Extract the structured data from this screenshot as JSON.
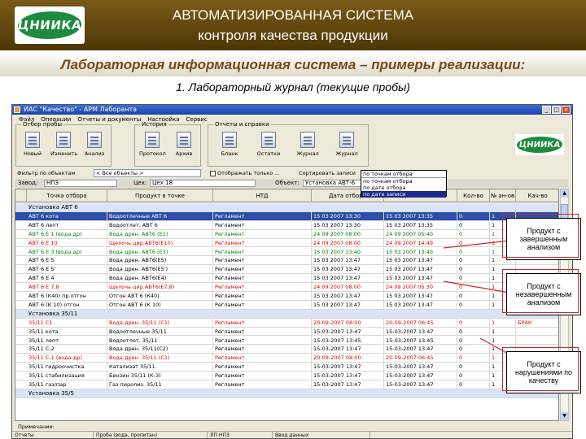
{
  "banner": {
    "logo_text": "ЦНИИКА",
    "title_line1": "АВТОМАТИЗИРОВАННАЯ СИСТЕМА",
    "title_line2": "контроля качества продукции"
  },
  "subtitle": "Лабораторная информационная система – примеры реализации:",
  "caption": "1. Лабораторный журнал (текущие пробы)",
  "window": {
    "title": "ИАС \"Качество\" - АРМ Лаборанта",
    "menu": [
      "Файл",
      "Операции",
      "Отчеты и документы",
      "Настройка",
      "Сервис"
    ],
    "toolbar_groups": [
      {
        "title": "Отбор пробы",
        "buttons": [
          "Новый",
          "Изменить",
          "Анализ"
        ]
      },
      {
        "title": "История",
        "buttons": [
          "Протокол",
          "Архив"
        ]
      },
      {
        "title": "Отчеты и справки",
        "buttons": [
          "Бланк",
          "Остатки",
          "Журнал",
          "Журнал"
        ]
      }
    ],
    "logo_text": "ЦНИИКА",
    "filter": {
      "label": "Фильтр по объектам",
      "value": "< Все объекты >",
      "checkbox_label": "Отображать только ..."
    },
    "sort": {
      "label": "Сортировать записи",
      "value": "по точкам отбора",
      "options": [
        "по точкам отбора",
        "по дате отбора",
        "по дате записи"
      ],
      "selected": "по дате записи"
    },
    "info": {
      "plant_label": "Завод:",
      "plant_value": "НПЗ",
      "shop_label": "Цех:",
      "shop_value": "Цех 18",
      "object_label": "Объект:",
      "object_value": "Установка АВТ-6"
    },
    "columns": [
      "Точка отбора",
      "Продукт в точке",
      "НТД",
      "Дата отбора",
      "Дата записи",
      "Кол-во",
      "№ ан-ов",
      "Кач-во"
    ],
    "rows": [
      {
        "kind": "group",
        "text": "Установка АВТ 6"
      },
      {
        "kind": "selrow",
        "cells": [
          "АВТ 6 кота",
          "Водоотлечные АВТ 6",
          "Регламент",
          "15 03 2007 13:30",
          "15 03 2007 13:35",
          "0",
          "1",
          ""
        ]
      },
      {
        "kind": "normal",
        "cells": [
          "АВТ 6 лепт",
          "Водоотлет. АВТ 6",
          "Регламент",
          "15 03 2007 13:30",
          "15 03 2007 13:35",
          "0",
          "1",
          ""
        ]
      },
      {
        "kind": "green",
        "cells": [
          "АВТ 6 Е 1 (вода др)",
          "Вода дрен. АВТ6 (Е1)",
          "Регламент",
          "24 09 2007 08:00",
          "24 09 2007 05:40",
          "0",
          "1",
          "БРАК"
        ]
      },
      {
        "kind": "red",
        "cells": [
          "АВТ 6 Е 10",
          "Щелочь цир.АВТ6(Е10)",
          "Регламент",
          "24 09 2007 08:00",
          "24 09 2007 14:49",
          "0",
          "1",
          "БРАК"
        ]
      },
      {
        "kind": "green",
        "cells": [
          "АВТ 6 Е 3 (вода др)",
          "Вода дрен. АВТ6 (Е3)",
          "Регламент",
          "15 03 2007 13:40",
          "15 03 2007 13:40",
          "0",
          "1",
          ""
        ]
      },
      {
        "kind": "normal",
        "cells": [
          "АВТ 6 Е 5",
          "Вода дрен. АВТ6(Е5)",
          "Регламент",
          "15 03 2007 13:47",
          "15 03 2007 13:47",
          "0",
          "1",
          ""
        ]
      },
      {
        "kind": "normal",
        "cells": [
          "АВТ 6 Е 5'",
          "Вода дрен. АВТ6(Е5')",
          "Регламент",
          "15 03 2007 13:47",
          "15 03 2007 13:47",
          "0",
          "1",
          ""
        ]
      },
      {
        "kind": "normal",
        "cells": [
          "АВТ 6 Е 4",
          "Вода дрен. АВТ6(Е4)",
          "Регламент",
          "15 03 2007 13:47",
          "15 03 2007 13:47",
          "0",
          "1",
          ""
        ]
      },
      {
        "kind": "red",
        "cells": [
          "АВТ 6 Е 7,8",
          "Щелочь цир.АВТ6(Е7,8)",
          "Регламент",
          "24 09 2007 08:00",
          "24 09 2007 05:30",
          "0",
          "1",
          "БРАК"
        ]
      },
      {
        "kind": "normal",
        "cells": [
          "АВТ 6 (К40) пр.отгон",
          "Отгон АВТ 6 (К40)",
          "Регламент",
          "15 03 2007 13:47",
          "15 03 2007 13:47",
          "0",
          "1",
          ""
        ]
      },
      {
        "kind": "normal",
        "cells": [
          "АВТ 6 (К 10) отгон",
          "Отгон АВТ 6 (К 10)",
          "Регламент",
          "15 03 2007 13:47",
          "15 03 2007 13:47",
          "0",
          "1",
          ""
        ]
      },
      {
        "kind": "group",
        "text": "Установка 35/11"
      },
      {
        "kind": "red",
        "cells": [
          "35/11 С1",
          "Вода дрен. 35/11 (С1)",
          "Регламент",
          "20-09-2007 08:00",
          "20-09-2007 06:45",
          "0",
          "1",
          "БРАК"
        ]
      },
      {
        "kind": "normal",
        "cells": [
          "35/11 кота",
          "Водоотлечные 35/11",
          "Регламент",
          "15-03-2007 13:47",
          "15-03-2007 13:47",
          "0",
          "1",
          ""
        ]
      },
      {
        "kind": "normal",
        "cells": [
          "35/11 лепт",
          "Водоотлет. 35/11",
          "Регламент",
          "15-03-2007 13:45",
          "15-03-2007 13:45",
          "0",
          "1",
          ""
        ]
      },
      {
        "kind": "normal",
        "cells": [
          "35/11 С-2",
          "Вода дрен. 35/11(С2)",
          "Регламент",
          "15-03-2007 13:47",
          "15-03-2007 13:47",
          "0",
          "1",
          ""
        ]
      },
      {
        "kind": "red",
        "cells": [
          "35/11 С-1 (вода др)",
          "Вода дрен. 35/11 (С1)",
          "Регламент",
          "20-09-2007 08:00",
          "20-09-2007 06:45",
          "0",
          "1",
          "БРАК"
        ]
      },
      {
        "kind": "normal",
        "cells": [
          "35/11 гидроочистка",
          "Катализат 35/11",
          "Регламент",
          "15-03-2007 13:47",
          "15-03-2007 13:47",
          "0",
          "1",
          ""
        ]
      },
      {
        "kind": "normal",
        "cells": [
          "35/11 стабилизация",
          "Бензин 35/11 (К-3)",
          "Регламент",
          "15-03-2007 13:47",
          "15-03-2007 13:47",
          "0",
          "1",
          ""
        ]
      },
      {
        "kind": "normal",
        "cells": [
          "35/11 газ/пар",
          "Газ пиролиз. 35/11",
          "Регламент",
          "15-03-2007 13:47",
          "15-03-2007 13:47",
          "0",
          "1",
          ""
        ]
      },
      {
        "kind": "group",
        "text": "Установка 35/5"
      }
    ],
    "notes_label": "Примечание:",
    "status": [
      "Отчеты",
      "Проба (вода, пропитан)",
      "ЛП НПЗ",
      "Ввод данных"
    ]
  },
  "callouts": [
    {
      "text": "Продукт с завершенным анализом"
    },
    {
      "text": "Продукт с незавершенным анализом"
    },
    {
      "text": "Продукт с нарушениями по качеству"
    }
  ]
}
